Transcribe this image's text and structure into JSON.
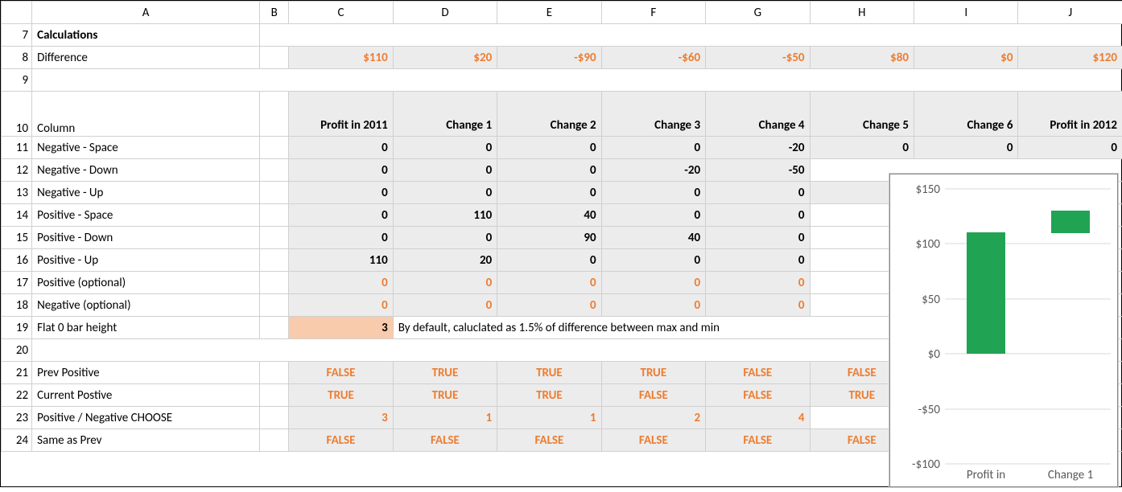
{
  "columns": [
    "A",
    "B",
    "C",
    "D",
    "E",
    "F",
    "G",
    "H",
    "I",
    "J"
  ],
  "row_numbers": [
    "7",
    "8",
    "9",
    "10",
    "11",
    "12",
    "13",
    "14",
    "15",
    "16",
    "17",
    "18",
    "19",
    "20",
    "21",
    "22",
    "23",
    "24"
  ],
  "labels": {
    "r7": "Calculations",
    "r8": "Difference",
    "r10": "Column",
    "r11": "Negative - Space",
    "r12": "Negative - Down",
    "r13": "Negative - Up",
    "r14": "Positive - Space",
    "r15": "Positive - Down",
    "r16": "Positive - Up",
    "r17": "Positive (optional)",
    "r18": "Negative (optional)",
    "r19": "Flat 0 bar height",
    "r21": "Prev Positive",
    "r22": "Current Postive",
    "r23": "Positive / Negative CHOOSE",
    "r24": "Same as Prev"
  },
  "row8": [
    "$110",
    "$20",
    "-$90",
    "-$60",
    "-$50",
    "$80",
    "$0",
    "$120"
  ],
  "row10": [
    "Profit in 2011",
    "Change 1",
    "Change 2",
    "Change 3",
    "Change 4",
    "Change 5",
    "Change 6",
    "Profit in 2012"
  ],
  "row11": [
    "0",
    "0",
    "0",
    "0",
    "-20",
    "0",
    "0",
    "0"
  ],
  "row12": [
    "0",
    "0",
    "0",
    "-20",
    "-50"
  ],
  "row13": [
    "0",
    "0",
    "0",
    "0",
    "0"
  ],
  "row14": [
    "0",
    "110",
    "40",
    "0",
    "0"
  ],
  "row15": [
    "0",
    "0",
    "90",
    "40",
    "0"
  ],
  "row16": [
    "110",
    "20",
    "0",
    "0",
    "0"
  ],
  "row17": [
    "0",
    "0",
    "0",
    "0",
    "0"
  ],
  "row18": [
    "0",
    "0",
    "0",
    "0",
    "0"
  ],
  "row19_val": "3",
  "row19_note": "By default, caluclated as 1.5% of difference between max and min",
  "row21": [
    "FALSE",
    "TRUE",
    "TRUE",
    "TRUE",
    "FALSE",
    "FALSE"
  ],
  "row22": [
    "TRUE",
    "TRUE",
    "TRUE",
    "FALSE",
    "FALSE",
    "TRUE"
  ],
  "row23": [
    "3",
    "1",
    "1",
    "2",
    "4"
  ],
  "row24": [
    "FALSE",
    "FALSE",
    "FALSE",
    "FALSE",
    "FALSE",
    "FALSE"
  ],
  "chart_data": {
    "type": "bar",
    "categories": [
      "Profit in",
      "Change 1"
    ],
    "series": [
      {
        "name": "Profit in 2011",
        "base": 0,
        "value": 110
      },
      {
        "name": "Change 1",
        "base": 110,
        "value": 20
      }
    ],
    "y_ticks": [
      "-$100",
      "-$50",
      "$0",
      "$50",
      "$100",
      "$150"
    ],
    "ylim": [
      -100,
      150
    ]
  }
}
